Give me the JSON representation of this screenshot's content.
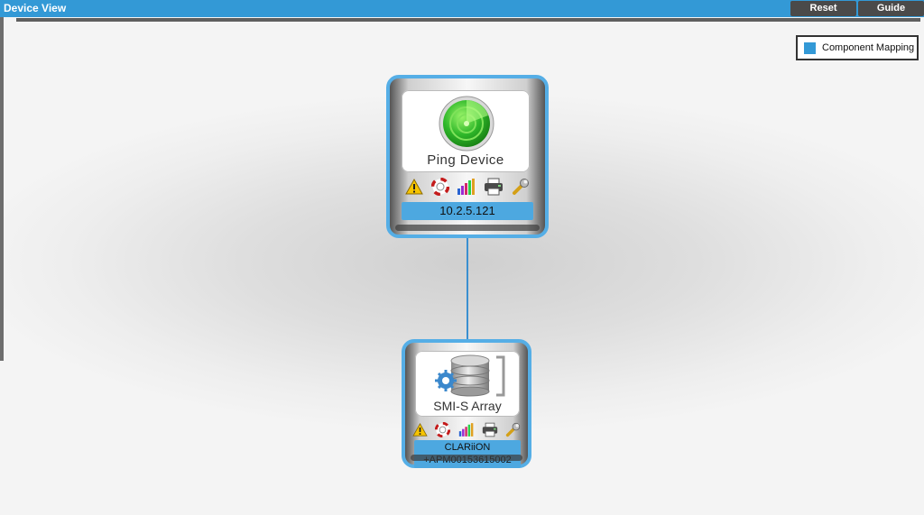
{
  "header": {
    "title": "Device View",
    "reset_label": "Reset",
    "guide_label": "Guide"
  },
  "legend": {
    "label": "Component Mapping",
    "swatch_color": "#3399d6"
  },
  "nodes": [
    {
      "name": "Ping Device",
      "label": "10.2.5.121",
      "icon": "radar-icon"
    },
    {
      "name": "SMI-S Array",
      "label_line1": "CLARiiON",
      "label_line2": "+APM00153615002",
      "icon": "storage-array-icon"
    }
  ],
  "node_action_icons": [
    "warning-icon",
    "lifebuoy-icon",
    "bar-chart-icon",
    "printer-icon",
    "wrench-icon"
  ],
  "colors": {
    "accent": "#3399d6",
    "node_border": "#55aee6",
    "label_bar": "#4da8e0"
  }
}
